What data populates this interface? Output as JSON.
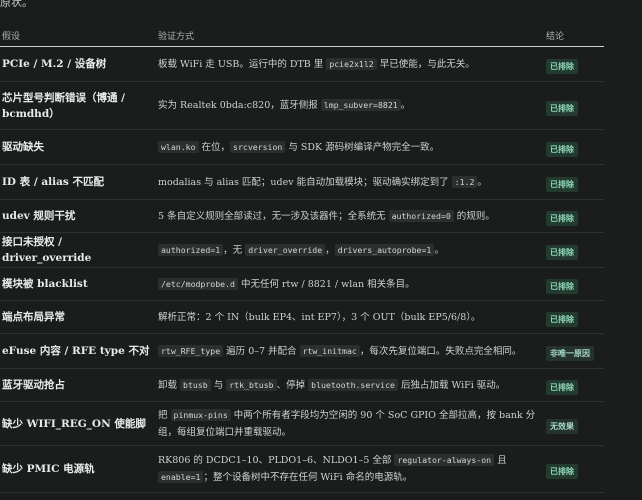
{
  "intro": "原状。",
  "headers": {
    "hypothesis": "假设",
    "method": "验证方式",
    "conclusion": "结论"
  },
  "colors": {
    "background": "#1b1d1c",
    "badge_text": "#8fd9b9",
    "badge_bg": "#223a30"
  },
  "rows": [
    {
      "hypothesis": "PCIe / M.2 / 设备树",
      "method": [
        {
          "t": "板载 WiFi 走 USB。运行中的 DTB 里 "
        },
        {
          "c": "pcie2x1l2"
        },
        {
          "t": " 早已使能，与此无关。"
        }
      ],
      "conclusion": "已排除"
    },
    {
      "hypothesis": "芯片型号判断错误（博通 / bcmdhd）",
      "method": [
        {
          "t": "实为 Realtek 0bda:c820，蓝牙侧报 "
        },
        {
          "c": "lmp_subver=8821"
        },
        {
          "t": "。"
        }
      ],
      "conclusion": "已排除"
    },
    {
      "hypothesis": "驱动缺失",
      "method": [
        {
          "c": "wlan.ko"
        },
        {
          "t": " 在位，"
        },
        {
          "c": "srcversion"
        },
        {
          "t": " 与 SDK 源码树编译产物完全一致。"
        }
      ],
      "conclusion": "已排除"
    },
    {
      "hypothesis": "ID 表 / alias 不匹配",
      "method": [
        {
          "t": "modalias 与 alias 匹配；udev 能自动加载模块；驱动确实绑定到了 "
        },
        {
          "c": ":1.2"
        },
        {
          "t": "。"
        }
      ],
      "conclusion": "已排除"
    },
    {
      "hypothesis": "udev 规则干扰",
      "method": [
        {
          "t": "5 条自定义规则全部读过，无一涉及该器件；全系统无 "
        },
        {
          "c": "authorized=0"
        },
        {
          "t": " 的规则。"
        }
      ],
      "conclusion": "已排除"
    },
    {
      "hypothesis": "接口未授权 / driver_override",
      "method": [
        {
          "c": "authorized=1"
        },
        {
          "t": "，无 "
        },
        {
          "c": "driver_override"
        },
        {
          "t": "，"
        },
        {
          "c": "drivers_autoprobe=1"
        },
        {
          "t": "。"
        }
      ],
      "conclusion": "已排除"
    },
    {
      "hypothesis": "模块被 blacklist",
      "method": [
        {
          "c": "/etc/modprobe.d"
        },
        {
          "t": " 中无任何 rtw / 8821 / wlan 相关条目。"
        }
      ],
      "conclusion": "已排除"
    },
    {
      "hypothesis": "端点布局异常",
      "method": [
        {
          "t": "解析正常：2 个 IN（bulk EP4、int EP7），3 个 OUT（bulk EP5/6/8）。"
        }
      ],
      "conclusion": "已排除"
    },
    {
      "hypothesis": "eFuse 内容 / RFE type 不对",
      "method": [
        {
          "c": "rtw_RFE_type"
        },
        {
          "t": " 遍历 0–7 并配合 "
        },
        {
          "c": "rtw_initmac"
        },
        {
          "t": "，每次先复位端口。失败点完全相同。"
        }
      ],
      "conclusion": "非唯一原因",
      "alt": true
    },
    {
      "hypothesis": "蓝牙驱动抢占",
      "method": [
        {
          "t": "卸载 "
        },
        {
          "c": "btusb"
        },
        {
          "t": " 与 "
        },
        {
          "c": "rtk_btusb"
        },
        {
          "t": "、停掉 "
        },
        {
          "c": "bluetooth.service"
        },
        {
          "t": " 后独占加载 WiFi 驱动。"
        }
      ],
      "conclusion": "已排除"
    },
    {
      "hypothesis": "缺少 WIFI_REG_ON 使能脚",
      "method": [
        {
          "t": "把 "
        },
        {
          "c": "pinmux-pins"
        },
        {
          "t": " 中两个所有者字段均为空闲的 90 个 SoC GPIO 全部拉高，按 bank 分组，每组复位端口并重载驱动。"
        }
      ],
      "conclusion": "无效果",
      "alt": true
    },
    {
      "hypothesis": "缺少 PMIC 电源轨",
      "method": [
        {
          "t": "RK806 的 DCDC1–10、PLDO1–6、NLDO1–5 全部 "
        },
        {
          "c": "regulator-always-on"
        },
        {
          "t": " 且 "
        },
        {
          "c": "enable=1"
        },
        {
          "t": "；整个设备树中不存在任何 WiFi 命名的电源轨。"
        }
      ],
      "conclusion": "已排除"
    }
  ]
}
